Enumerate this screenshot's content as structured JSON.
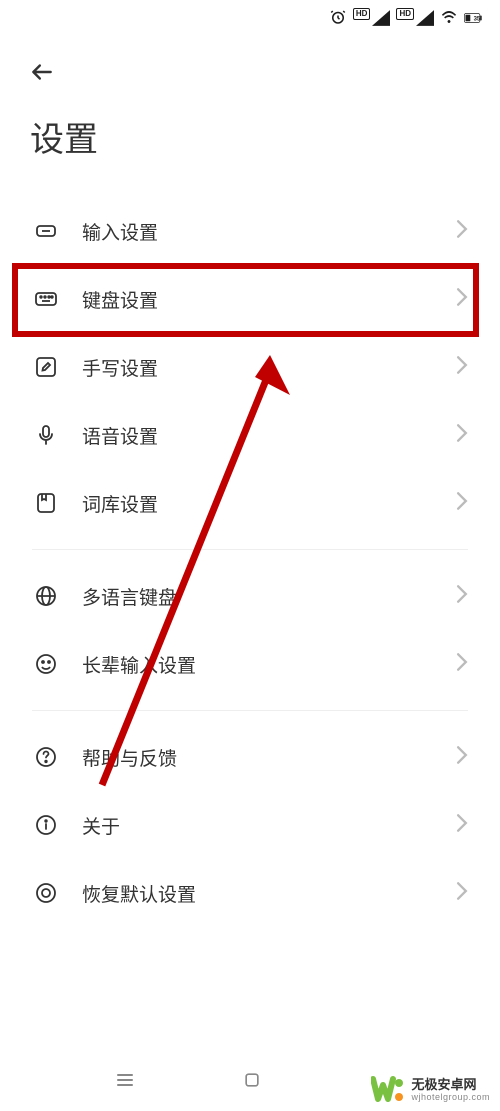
{
  "status": {
    "battery": "35"
  },
  "header": {
    "title": "设置"
  },
  "groups": [
    {
      "items": [
        {
          "icon": "input-icon",
          "label": "输入设置"
        },
        {
          "icon": "keyboard-icon",
          "label": "键盘设置"
        },
        {
          "icon": "handwrite-icon",
          "label": "手写设置"
        },
        {
          "icon": "voice-icon",
          "label": "语音设置"
        },
        {
          "icon": "dictionary-icon",
          "label": "词库设置"
        }
      ]
    },
    {
      "items": [
        {
          "icon": "globe-icon",
          "label": "多语言键盘"
        },
        {
          "icon": "elder-icon",
          "label": "长辈输入设置"
        }
      ]
    },
    {
      "items": [
        {
          "icon": "help-icon",
          "label": "帮助与反馈"
        },
        {
          "icon": "about-icon",
          "label": "关于"
        },
        {
          "icon": "reset-icon",
          "label": "恢复默认设置"
        }
      ]
    }
  ],
  "highlight": {
    "target_item_label": "键盘设置"
  },
  "footer": {
    "brand_cn": "无极安卓网",
    "brand_en": "wjhotelgroup.com"
  }
}
